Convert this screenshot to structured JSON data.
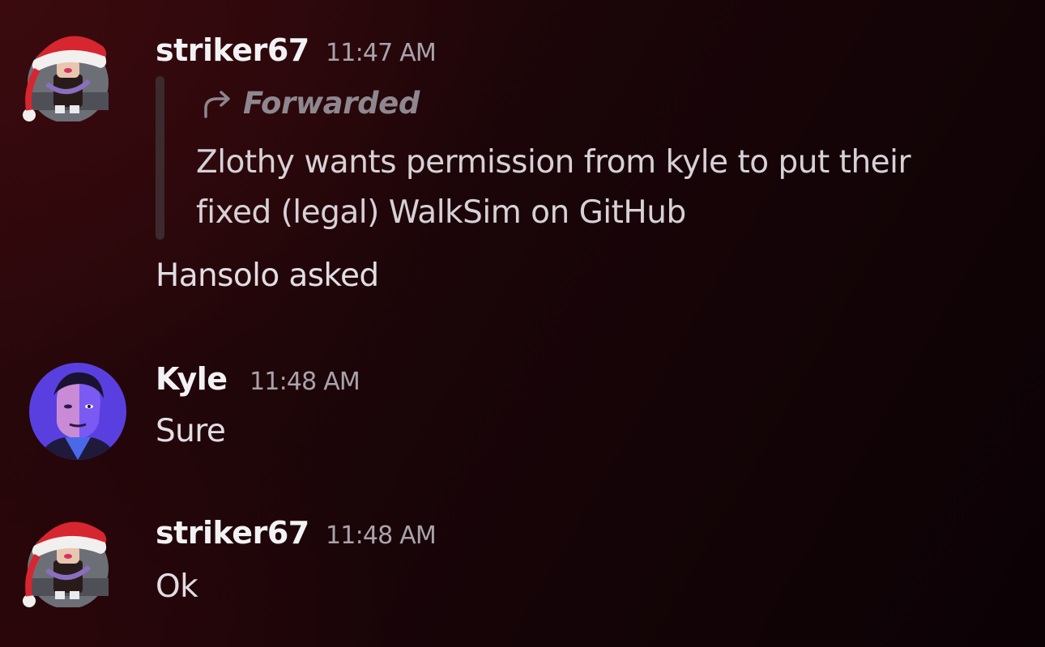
{
  "messages": [
    {
      "author": "striker67",
      "time": "11:47 AM",
      "avatar": "santa-hat-roblox-avatar",
      "forward": {
        "label": "Forwarded",
        "icon": "forward-arrow-icon",
        "lines": [
          "Zlothy wants permission from kyle to put their",
          "fixed (legal) WalkSim on GitHub"
        ]
      },
      "text": "Hansolo asked"
    },
    {
      "author": "Kyle",
      "time": "11:48 AM",
      "avatar": "duotone-portrait-avatar",
      "text": "Sure"
    },
    {
      "author": "striker67",
      "time": "11:48 AM",
      "avatar": "santa-hat-roblox-avatar",
      "text": "Ok"
    }
  ],
  "colors": {
    "username": "#f2f2f5",
    "timestamp": "#a9a3ab",
    "message": "#e1dde3",
    "forward_bar": "#3d2a2e",
    "kyle_avatar_bg": "#5a3fe0"
  }
}
